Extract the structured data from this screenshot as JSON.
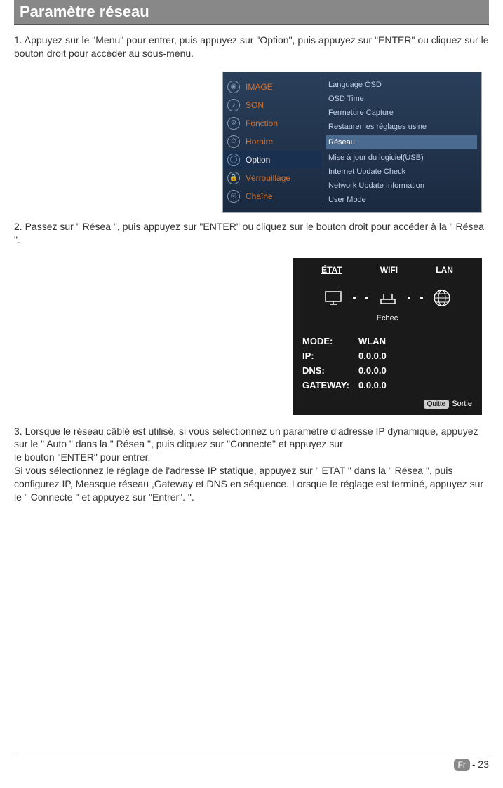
{
  "title": "Paramètre réseau",
  "step1": "1. Appuyez sur le \"Menu\" pour entrer, puis appuyez sur \"Option\", puis appuyez sur \"ENTER\" ou cliquez sur le bouton droit pour accéder au sous-menu.",
  "menu_left": {
    "items": [
      {
        "icon": "◉",
        "label": "IMAGE"
      },
      {
        "icon": "♪",
        "label": "SON"
      },
      {
        "icon": "⚙",
        "label": "Fonction"
      },
      {
        "icon": "⏱",
        "label": "Horaire"
      },
      {
        "icon": "◯",
        "label": "Option",
        "selected": true
      },
      {
        "icon": "🔒",
        "label": "Vérrouillage"
      },
      {
        "icon": "◎",
        "label": "Chaîne"
      }
    ]
  },
  "menu_right": {
    "items": [
      {
        "label": "Language  OSD"
      },
      {
        "label": "OSD Time"
      },
      {
        "label": "Fermeture Capture"
      },
      {
        "label": "Restaurer les réglages usine"
      },
      {
        "label": "Réseau",
        "hi": true
      },
      {
        "label": "Mise à jour du logiciel(USB)"
      },
      {
        "label": "Internet Update Check"
      },
      {
        "label": "Network Update Information"
      },
      {
        "label": "User Mode"
      }
    ]
  },
  "step2": "2. Passez sur \" Résea  \", puis appuyez sur \"ENTER\" ou cliquez sur le bouton droit pour accéder à la \" Résea \".",
  "net": {
    "tabs": {
      "a": "ÉTAT",
      "b": "WIFI",
      "c": "LAN"
    },
    "status": "Echec",
    "rows": {
      "mode": {
        "k": "MODE:",
        "v": "WLAN"
      },
      "ip": {
        "k": "IP:",
        "v": "0.0.0.0"
      },
      "dns": {
        "k": "DNS:",
        "v": "0.0.0.0"
      },
      "gw": {
        "k": "GATEWAY:",
        "v": "0.0.0.0"
      }
    },
    "exit_badge": "Quitte",
    "exit": "Sortie"
  },
  "step3": "3. Lorsque le réseau câblé est utilisé, si vous sélectionnez un paramètre d'adresse IP dynamique, appuyez sur le \" Auto \" dans la \" Résea \", puis    cliquez   sur \"Connecte\" et appuyez sur\nle bouton \"ENTER\" pour entrer.\nSi vous sélectionnez le réglage de l'adresse IP statique, appuyez sur \" ETAT \" dans la \" Résea \", puis configurez IP, Measque réseau ,Gateway et DNS en  séquence. Lorsque le réglage est terminé, appuyez sur le \" Connecte \" et appuyez sur \"Entrer\". \".",
  "footer": {
    "badge": "Fr",
    "page": "23"
  }
}
